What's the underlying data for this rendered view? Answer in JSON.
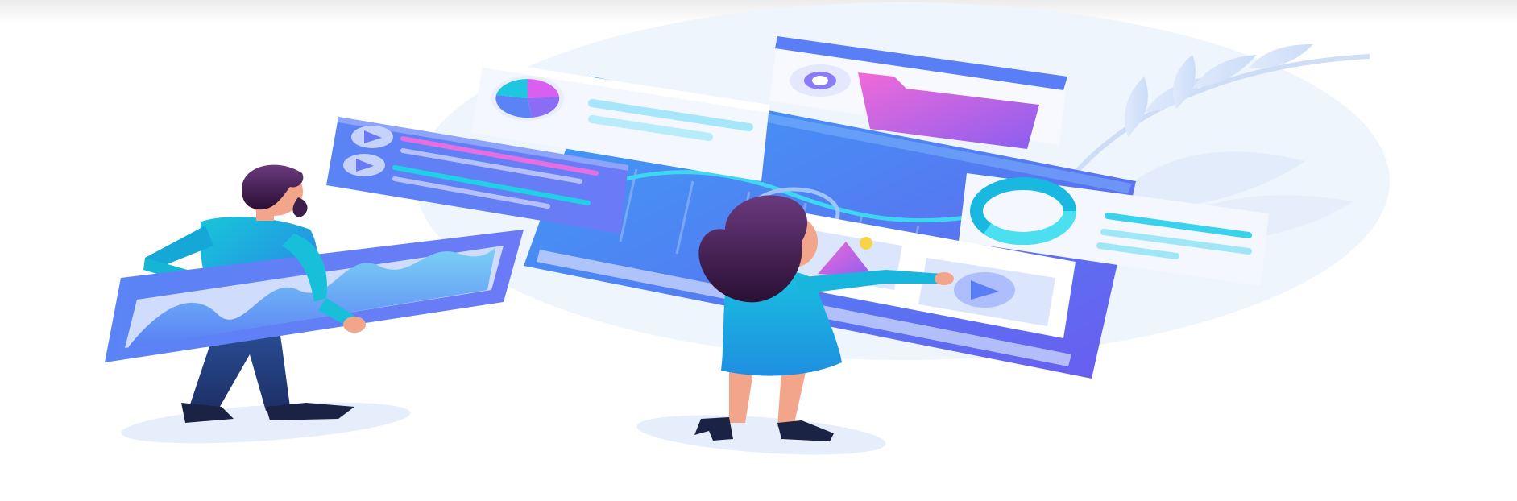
{
  "illustration": {
    "subject": "isometric-video-editing-workspace",
    "figures": [
      "man-holding-waveform-panel",
      "woman-touching-play-button"
    ],
    "icons": [
      "pie-chart-icon",
      "play-icon",
      "play-icon",
      "ring-chart-icon",
      "image-icon",
      "folder-icon",
      "toggle-icon",
      "leaf-icon"
    ]
  },
  "colors": {
    "background": "#ffffff",
    "ellipse": "#eef5fd",
    "panel_blue": "#4f8ef7",
    "panel_purple": "#6a5cf0",
    "card_light": "#eef3ff",
    "cyan": "#1fc6e0",
    "pink": "#e56ee0",
    "skin": "#f2a58a",
    "hair": "#3c1f4a",
    "shirt_teal": "#14b5d5",
    "pants_navy": "#223a78",
    "dress_teal": "#18a8d8"
  }
}
